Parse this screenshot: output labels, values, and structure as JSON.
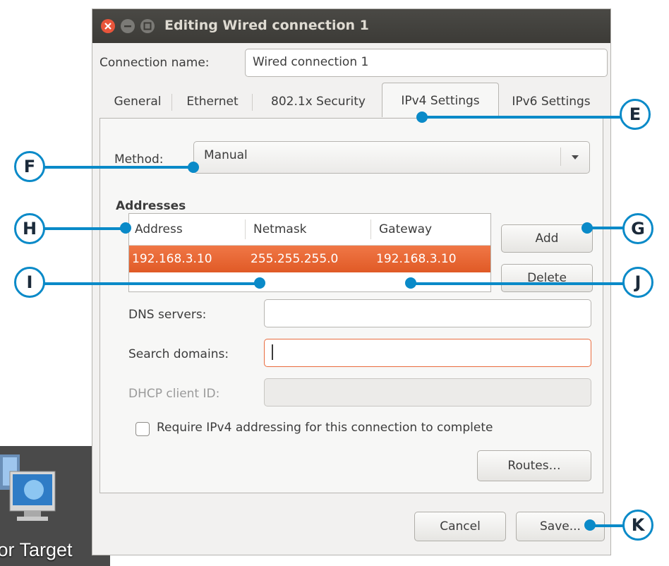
{
  "desktop": {
    "label": "For Target"
  },
  "window": {
    "title": "Editing Wired connection 1",
    "connection_name_label": "Connection name:",
    "connection_name_value": "Wired connection 1"
  },
  "tabs": [
    "General",
    "Ethernet",
    "802.1x Security",
    "IPv4 Settings",
    "IPv6 Settings"
  ],
  "active_tab": "IPv4 Settings",
  "ipv4": {
    "method_label": "Method:",
    "method_value": "Manual",
    "addresses_heading": "Addresses",
    "columns": [
      "Address",
      "Netmask",
      "Gateway"
    ],
    "rows": [
      {
        "address": "192.168.3.10",
        "netmask": "255.255.255.0",
        "gateway": "192.168.3.10"
      }
    ],
    "add_button": "Add",
    "delete_button": "Delete",
    "dns_label": "DNS servers:",
    "dns_value": "",
    "search_label": "Search domains:",
    "search_value": "",
    "dhcp_label": "DHCP client ID:",
    "dhcp_value": "",
    "require_checkbox_label": "Require IPv4 addressing for this connection to complete",
    "require_checked": false,
    "routes_button": "Routes…"
  },
  "footer": {
    "cancel_button": "Cancel",
    "save_button": "Save..."
  },
  "annotations": [
    "E",
    "F",
    "G",
    "H",
    "I",
    "J",
    "K"
  ],
  "colors": {
    "selection": "#e9602c",
    "annotation": "#0a8ac8",
    "titlebar": "#3c3b37",
    "close": "#e9553b"
  }
}
